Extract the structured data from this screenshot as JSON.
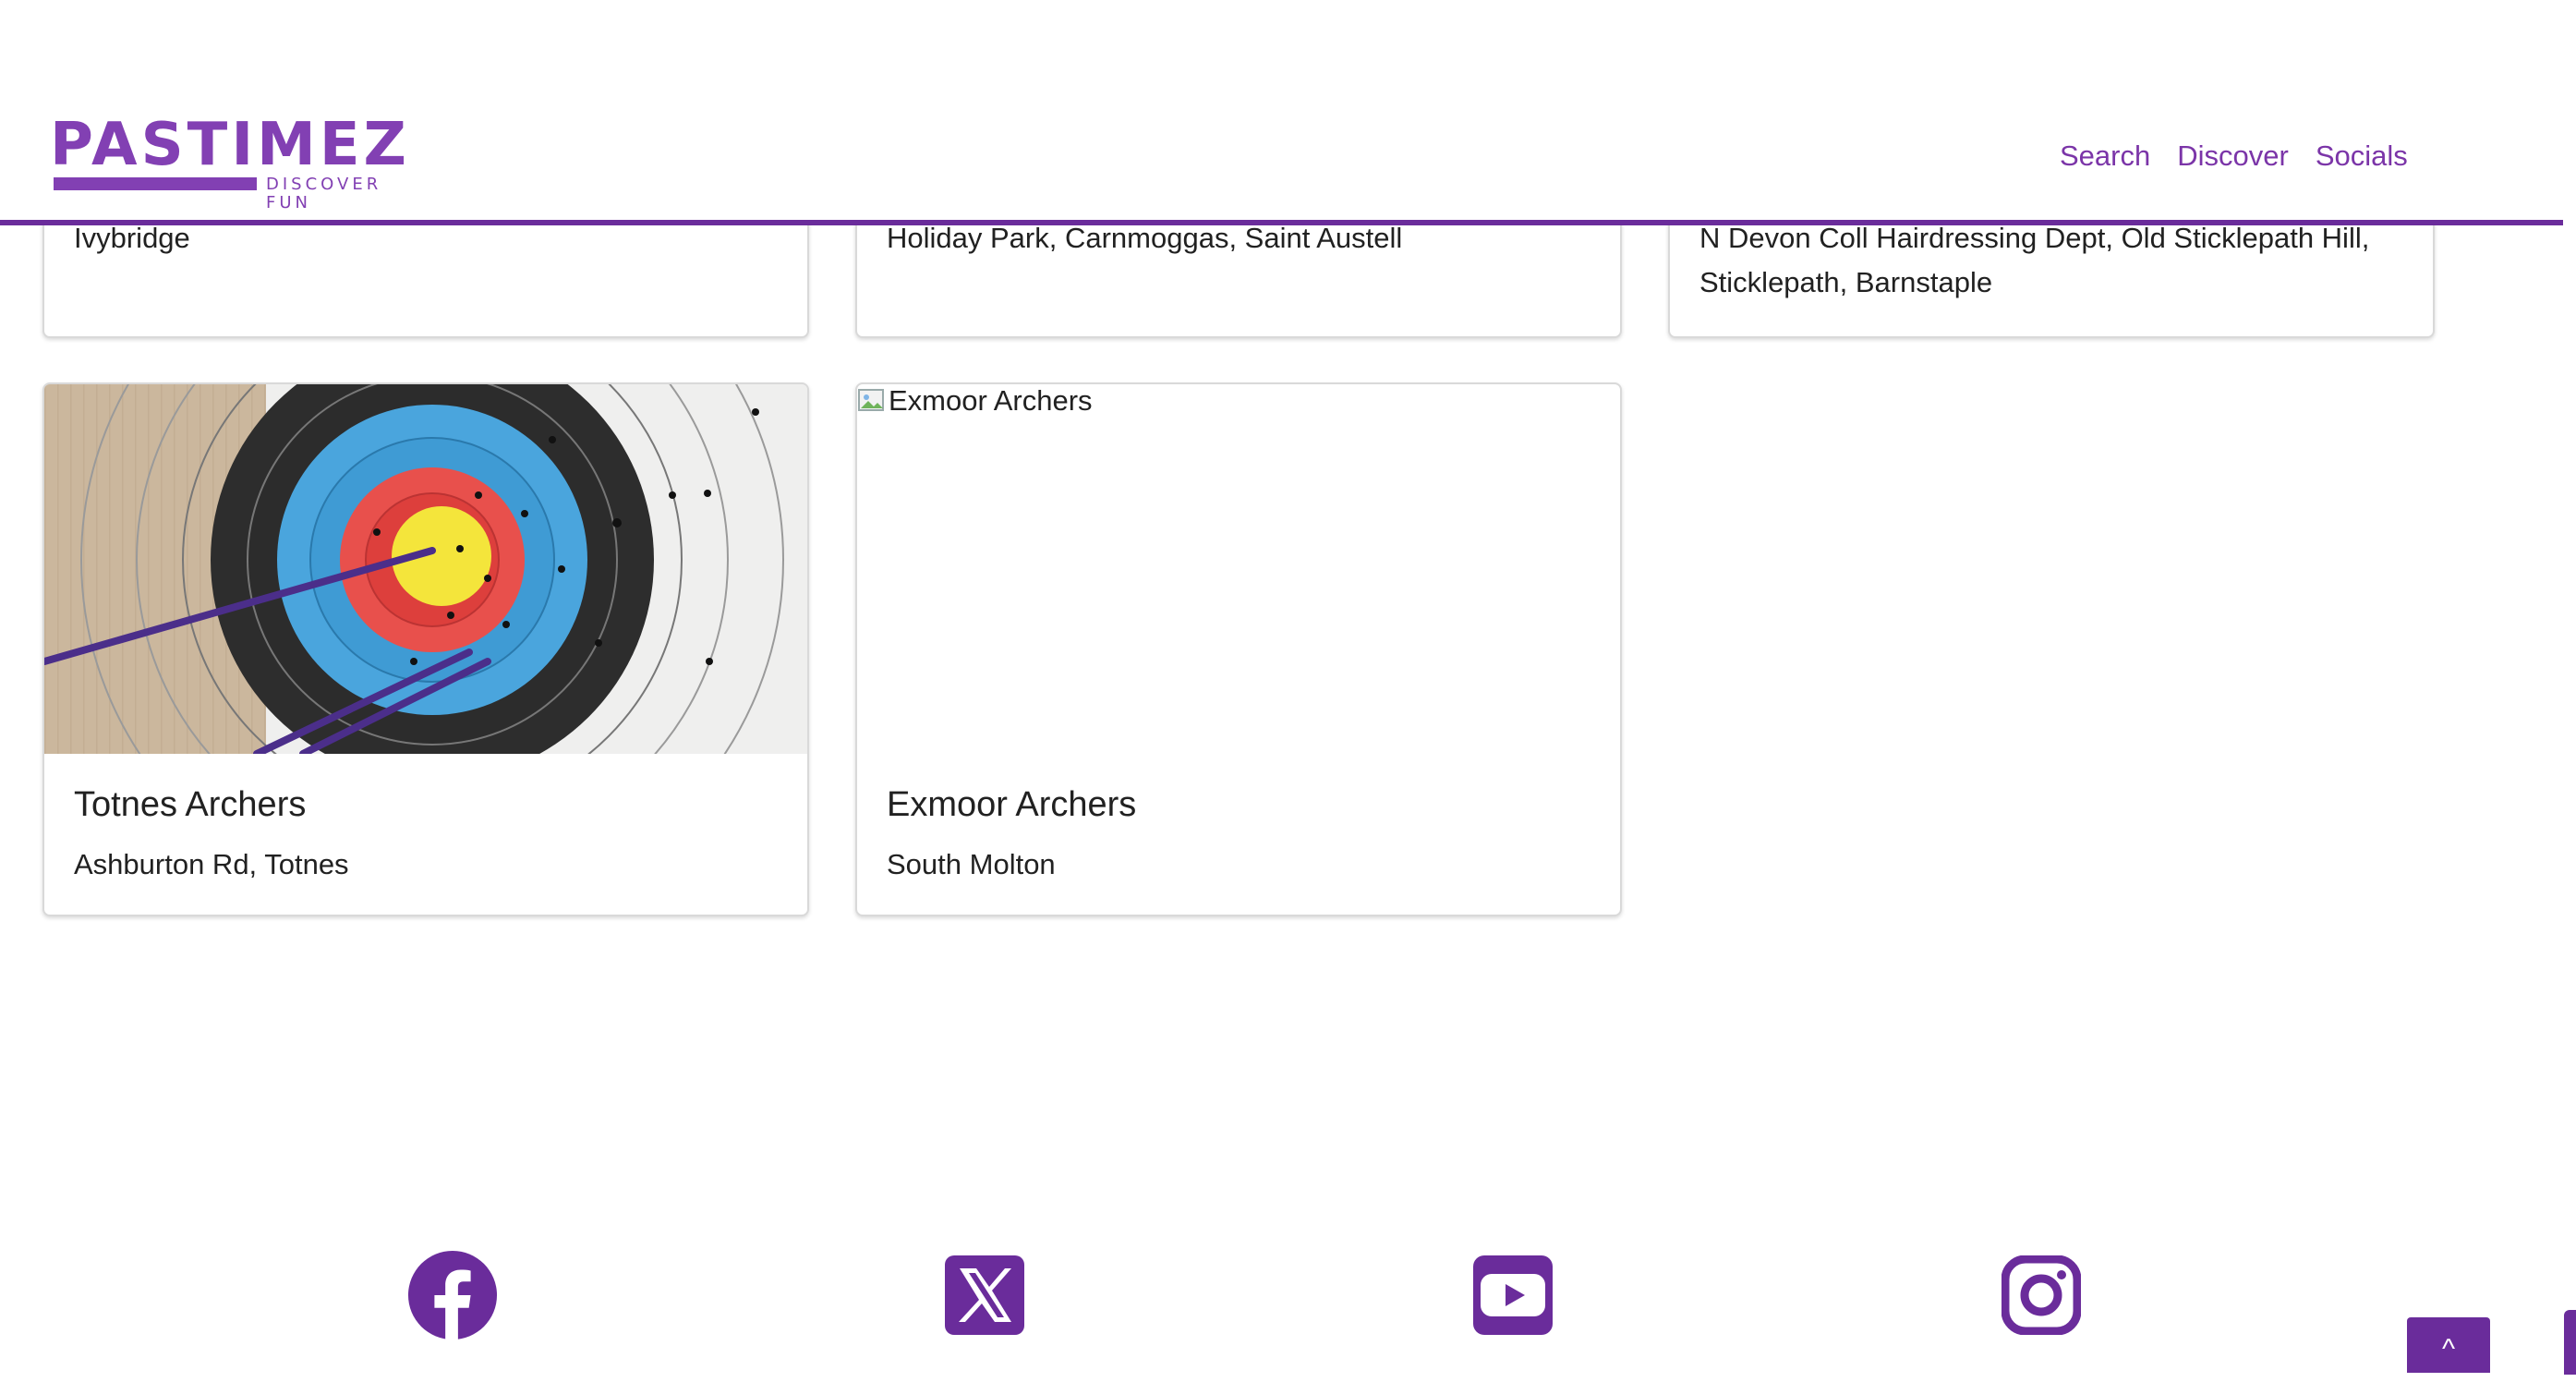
{
  "brand": {
    "name": "PASTIMEZ",
    "tagline": "DISCOVER FUN",
    "color": "#8240b3"
  },
  "nav": {
    "items": [
      "Search",
      "Discover",
      "Socials"
    ]
  },
  "cards_top": [
    {
      "address": "Ivybridge"
    },
    {
      "address": "Holiday Park, Carnmoggas, Saint Austell"
    },
    {
      "address": "N Devon Coll Hairdressing Dept, Old Sticklepath Hill, Sticklepath, Barnstaple"
    }
  ],
  "cards": [
    {
      "title": "Totnes Archers",
      "address": "Ashburton Rd, Totnes",
      "image": "archery-target-photo"
    },
    {
      "title": "Exmoor Archers",
      "address": "South Molton",
      "image_alt": "Exmoor Archers"
    }
  ],
  "footer": {
    "socials": [
      "facebook-icon",
      "x-icon",
      "youtube-icon",
      "instagram-icon"
    ],
    "to_top_label": "^"
  },
  "colors": {
    "accent": "#6a2c9b"
  }
}
